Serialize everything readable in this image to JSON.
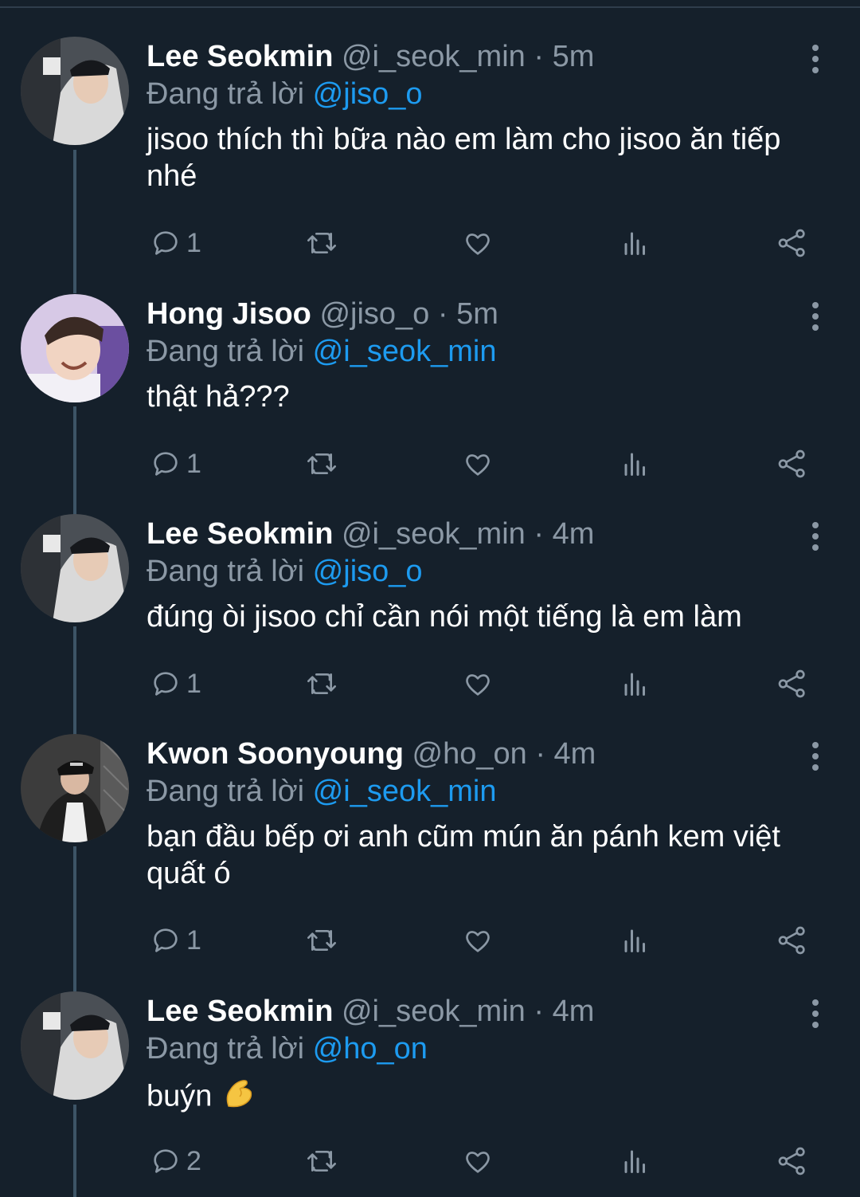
{
  "reply_prefix": "Đang trả lời",
  "tweets": [
    {
      "name": "Lee Seokmin",
      "handle": "@i_seok_min",
      "time": "5m",
      "reply_to": "@jiso_o",
      "text": "jisoo thích thì bữa nào em làm cho jisoo ăn tiếp nhé",
      "reply_count": "1",
      "avatar": "lee-seokmin-avatar"
    },
    {
      "name": "Hong Jisoo",
      "handle": "@jiso_o",
      "time": "5m",
      "reply_to": "@i_seok_min",
      "text": "thật hả???",
      "reply_count": "1",
      "avatar": "hong-jisoo-avatar"
    },
    {
      "name": "Lee Seokmin",
      "handle": "@i_seok_min",
      "time": "4m",
      "reply_to": "@jiso_o",
      "text": "đúng òi jisoo chỉ cần nói một tiếng là em làm",
      "reply_count": "1",
      "avatar": "lee-seokmin-avatar"
    },
    {
      "name": "Kwon Soonyoung",
      "handle": "@ho_on",
      "time": "4m",
      "reply_to": "@i_seok_min",
      "text": "bạn đầu bếp ơi anh cũm mún ăn pánh kem việt quất ó",
      "reply_count": "1",
      "avatar": "kwon-soonyoung-avatar"
    },
    {
      "name": "Lee Seokmin",
      "handle": "@i_seok_min",
      "time": "4m",
      "reply_to": "@ho_on",
      "text": "buýn",
      "emoji": "pinching-hand",
      "reply_count": "2",
      "avatar": "lee-seokmin-avatar"
    }
  ],
  "colors": {
    "background": "#15202b",
    "mention": "#1d9bf0",
    "secondary_text": "#8b98a5",
    "thread_line": "#3d5466"
  }
}
